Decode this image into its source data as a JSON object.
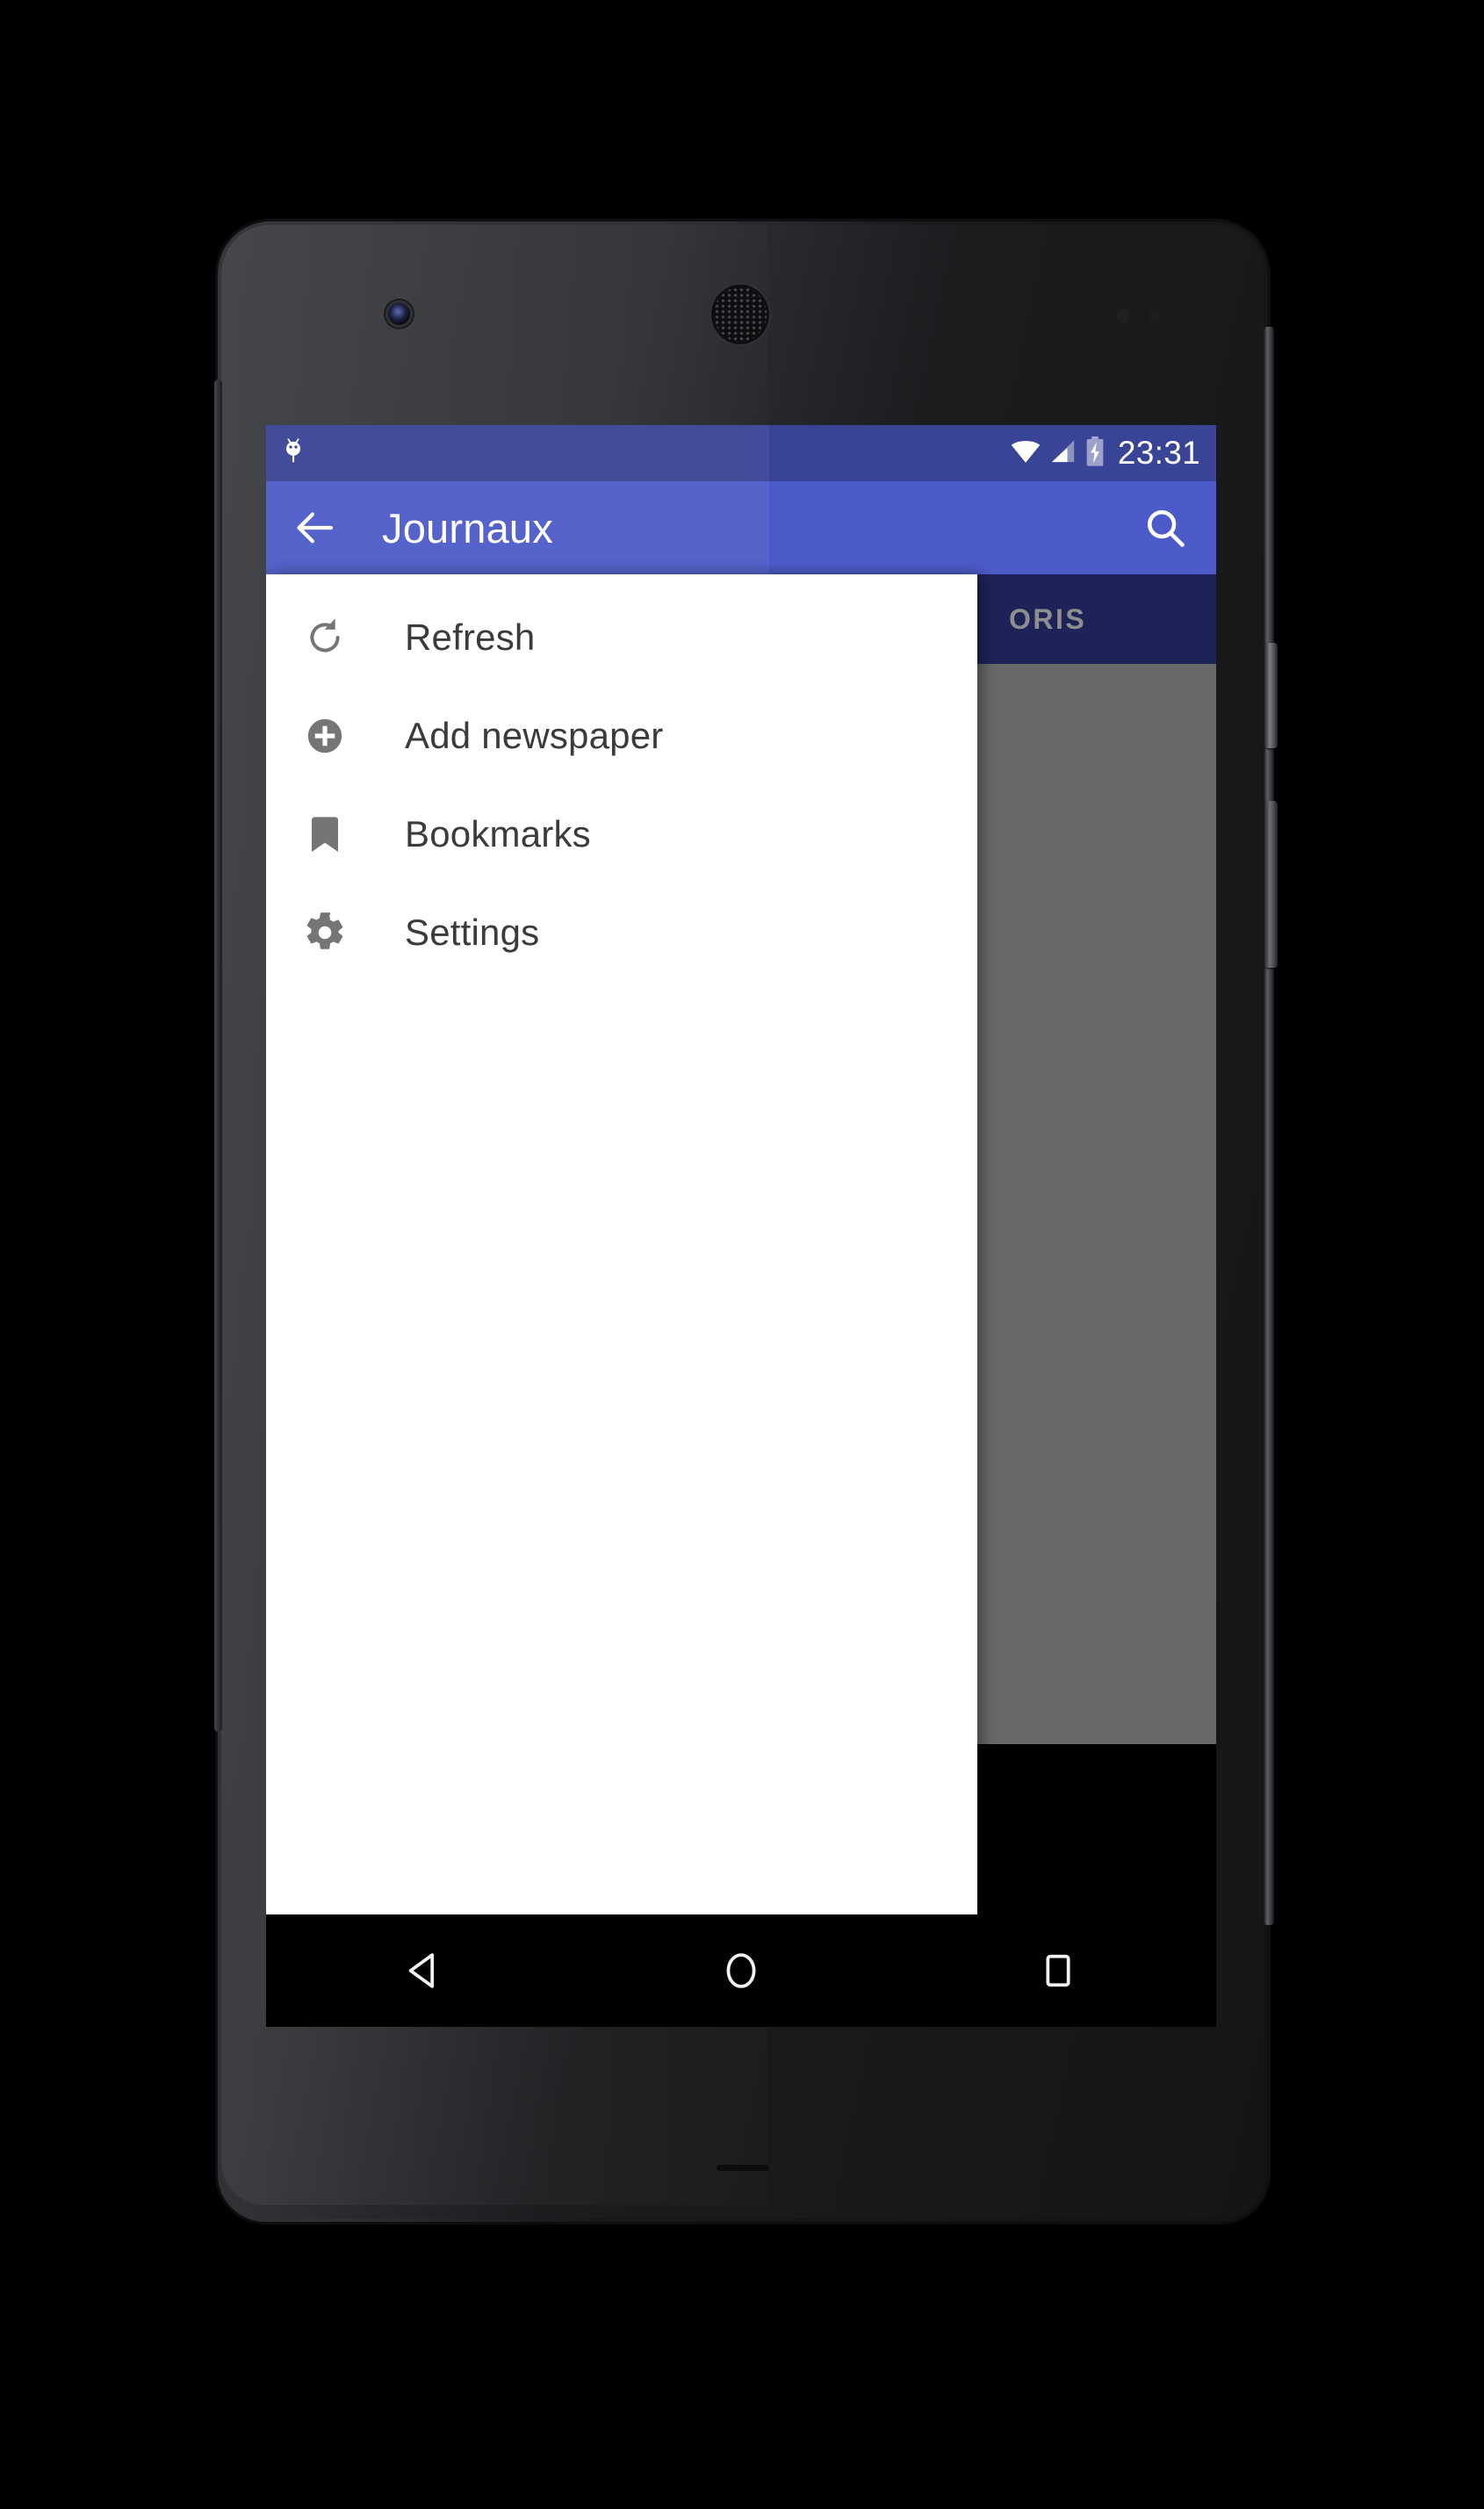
{
  "device": {
    "name": "android-phone-mockup"
  },
  "status_bar": {
    "time": "23:31",
    "icons": [
      "android-debug-icon",
      "wifi-icon",
      "cellular-signal-icon",
      "battery-charging-icon"
    ]
  },
  "toolbar": {
    "title": "Journaux",
    "back_icon": "arrow-back-icon",
    "search_icon": "search-icon"
  },
  "tabs": [
    {
      "label": "ORIS"
    }
  ],
  "drawer": {
    "items": [
      {
        "label": "Refresh",
        "icon": "refresh-icon"
      },
      {
        "label": "Add newspaper",
        "icon": "add-circle-icon"
      },
      {
        "label": "Bookmarks",
        "icon": "bookmark-icon"
      },
      {
        "label": "Settings",
        "icon": "gear-icon"
      }
    ]
  },
  "nav_bar": {
    "back_label": "back-triangle-icon",
    "home_label": "home-circle-icon",
    "recents_label": "recents-square-icon"
  },
  "colors": {
    "status_bar": "#3a4497",
    "toolbar": "#4c5bc9",
    "tab_strip": "#1d2257",
    "scrim": "#686868",
    "drawer_bg": "#ffffff",
    "icon_gray": "#757575",
    "label_gray": "#3b3b3b",
    "tab_text": "#8e8e8e"
  }
}
